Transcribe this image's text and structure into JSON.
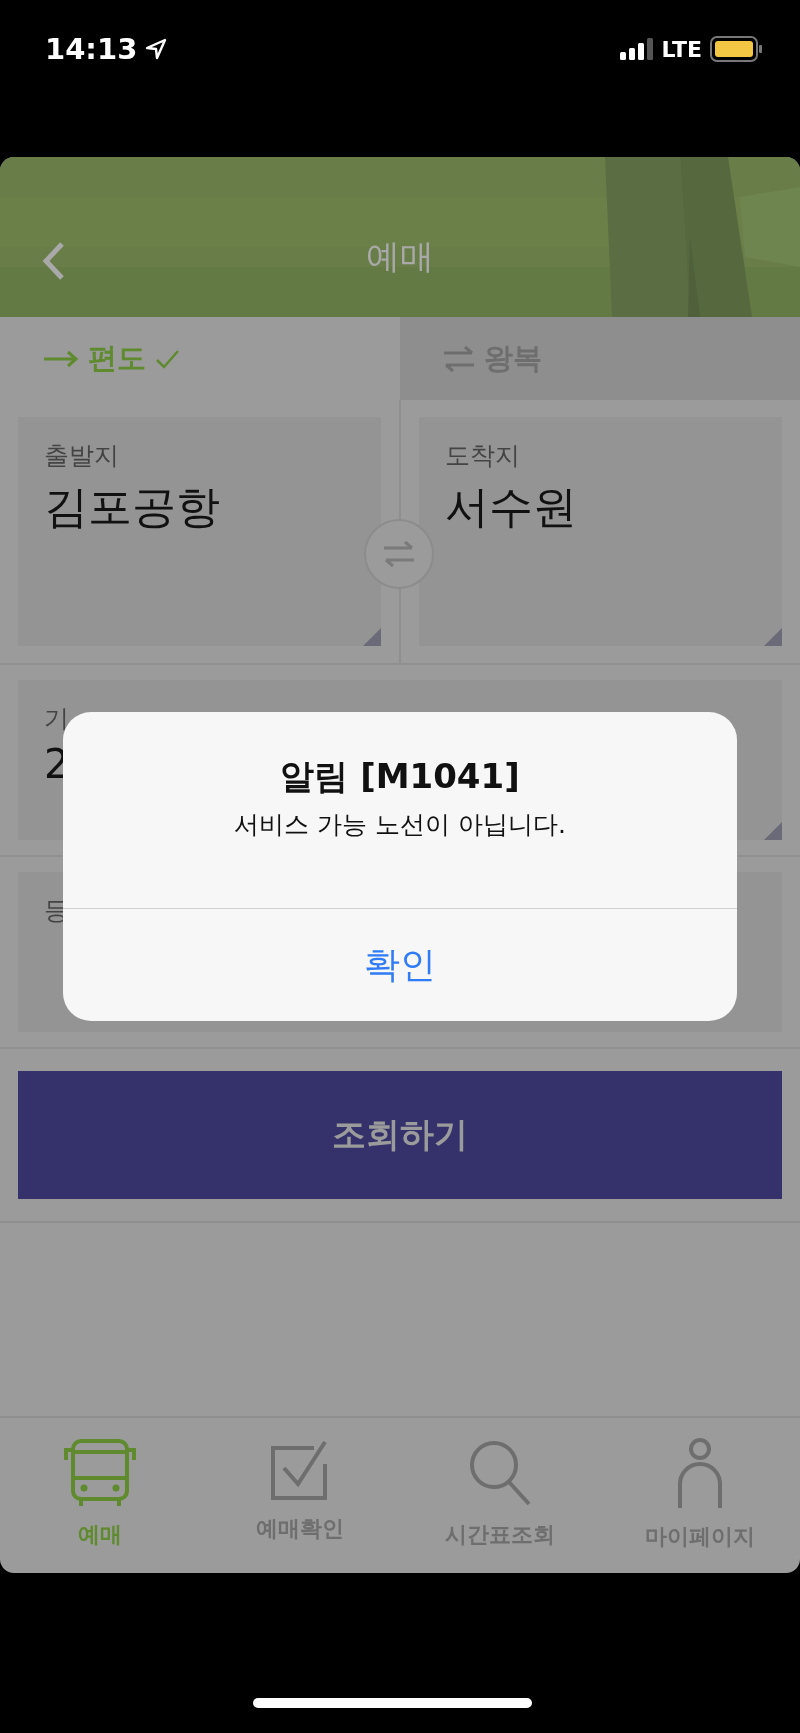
{
  "status_bar": {
    "time": "14:13",
    "network": "LTE"
  },
  "header": {
    "title": "예매"
  },
  "trip_tabs": [
    {
      "label": "편도",
      "selected": true
    },
    {
      "label": "왕복",
      "selected": false
    }
  ],
  "route": {
    "departure": {
      "label": "출발지",
      "value": "김포공항"
    },
    "arrival": {
      "label": "도착지",
      "value": "서수원"
    }
  },
  "date_field": {
    "label": "기",
    "value": "2"
  },
  "grade_field": {
    "label": "등"
  },
  "search_button": "조회하기",
  "alert": {
    "title": "알림 [M1041]",
    "message": "서비스 가능 노선이 아닙니다.",
    "button": "확인"
  },
  "nav": [
    {
      "label": "예매",
      "selected": true
    },
    {
      "label": "예매확인",
      "selected": false
    },
    {
      "label": "시간표조회",
      "selected": false
    },
    {
      "label": "마이페이지",
      "selected": false
    }
  ]
}
